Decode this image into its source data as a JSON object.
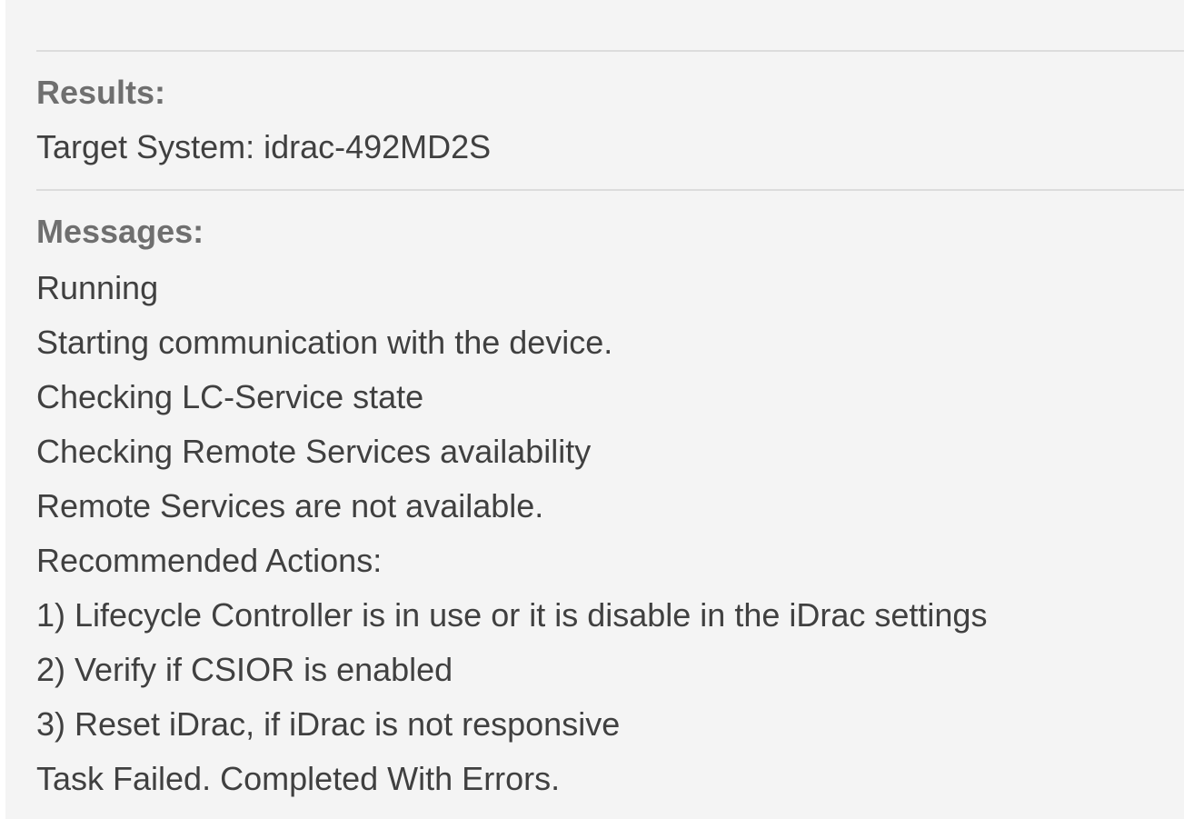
{
  "results": {
    "heading": "Results:",
    "target_system": "Target System: idrac-492MD2S"
  },
  "messages": {
    "heading": "Messages:",
    "lines": [
      "Running",
      "Starting communication with the device.",
      "Checking LC-Service state",
      "Checking Remote Services availability",
      "Remote Services are not available.",
      "Recommended Actions:",
      "1) Lifecycle Controller is in use or it is disable in the iDrac settings",
      "2) Verify if CSIOR is enabled",
      "3) Reset iDrac, if iDrac is not responsive",
      "Task Failed. Completed With Errors."
    ]
  }
}
